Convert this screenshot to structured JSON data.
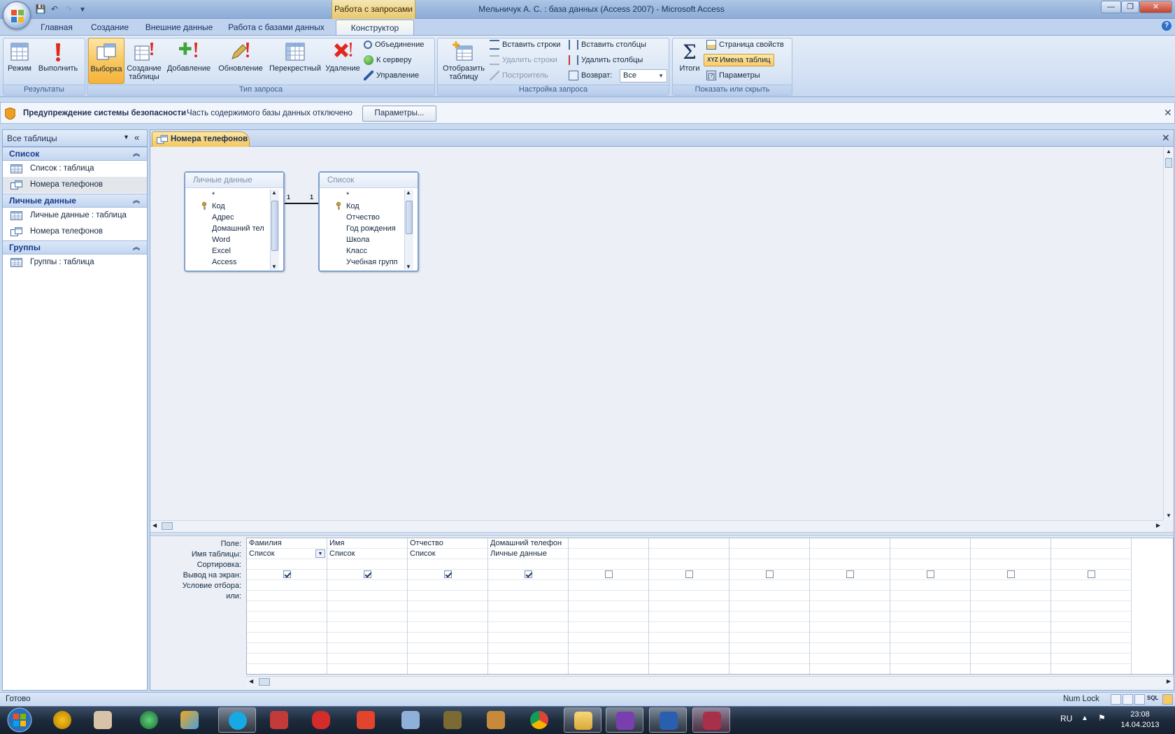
{
  "window": {
    "title": "Мельничук А. С. : база данных (Access 2007) - Microsoft Access",
    "context_tab": "Работа с запросами",
    "minimize": "—",
    "maximize": "❐",
    "close": "✕"
  },
  "ribbon_tabs": [
    "Главная",
    "Создание",
    "Внешние данные",
    "Работа с базами данных",
    "Конструктор"
  ],
  "ribbon": {
    "groups": {
      "results": "Результаты",
      "query_type": "Тип запроса",
      "query_setup": "Настройка запроса",
      "show_hide": "Показать или скрыть"
    },
    "buttons": {
      "mode": "Режим",
      "run": "Выполнить",
      "select": "Выборка",
      "make_table_1": "Создание",
      "make_table_2": "таблицы",
      "append": "Добавление",
      "update": "Обновление",
      "crosstab": "Перекрестный",
      "delete": "Удаление",
      "union": "Объединение",
      "pass_through": "К серверу",
      "data_definition": "Управление",
      "show_table_1": "Отобразить",
      "show_table_2": "таблицу",
      "insert_rows": "Вставить строки",
      "delete_rows": "Удалить строки",
      "builder": "Построитель",
      "insert_columns": "Вставить столбцы",
      "delete_columns": "Удалить столбцы",
      "return_label": "Возврат:",
      "return_value": "Все",
      "totals": "Итоги",
      "property_sheet": "Страница свойств",
      "table_names": "Имена таблиц",
      "parameters": "Параметры"
    }
  },
  "security": {
    "title": "Предупреждение системы безопасности",
    "message": "Часть содержимого базы данных отключено",
    "button": "Параметры..."
  },
  "nav": {
    "header": "Все таблицы",
    "groups": [
      {
        "label": "Список",
        "items": [
          "Список : таблица",
          "Номера телефонов"
        ]
      },
      {
        "label": "Личные данные",
        "items": [
          "Личные данные : таблица",
          "Номера телефонов"
        ]
      },
      {
        "label": "Группы",
        "items": [
          "Группы : таблица"
        ]
      }
    ]
  },
  "document": {
    "tab": "Номера телефонов",
    "tables": [
      {
        "name": "Личные данные",
        "fields": [
          "*",
          "Код",
          "Адрес",
          "Домашний тел",
          "Word",
          "Excel",
          "Access"
        ]
      },
      {
        "name": "Список",
        "fields": [
          "*",
          "Код",
          "Отчество",
          "Год рождения",
          "Школа",
          "Класс",
          "Учебная групп"
        ]
      }
    ],
    "relation": {
      "left": "1",
      "right": "1"
    }
  },
  "grid": {
    "row_labels": [
      "Поле:",
      "Имя таблицы:",
      "Сортировка:",
      "Вывод на экран:",
      "Условие отбора:",
      "или:"
    ],
    "columns": [
      {
        "field": "Фамилия",
        "table": "Список",
        "show": true
      },
      {
        "field": "Имя",
        "table": "Список",
        "show": true
      },
      {
        "field": "Отчество",
        "table": "Список",
        "show": true
      },
      {
        "field": "Домашний телефон",
        "table": "Личные данные",
        "show": true
      },
      {
        "field": "",
        "table": "",
        "show": false
      },
      {
        "field": "",
        "table": "",
        "show": false
      },
      {
        "field": "",
        "table": "",
        "show": false
      },
      {
        "field": "",
        "table": "",
        "show": false
      },
      {
        "field": "",
        "table": "",
        "show": false
      },
      {
        "field": "",
        "table": "",
        "show": false
      },
      {
        "field": "",
        "table": "",
        "show": false
      }
    ]
  },
  "status": {
    "text": "Готово",
    "numlock": "Num Lock"
  },
  "taskbar": {
    "lang": "RU",
    "time": "23:08",
    "date": "14.04.2013"
  }
}
